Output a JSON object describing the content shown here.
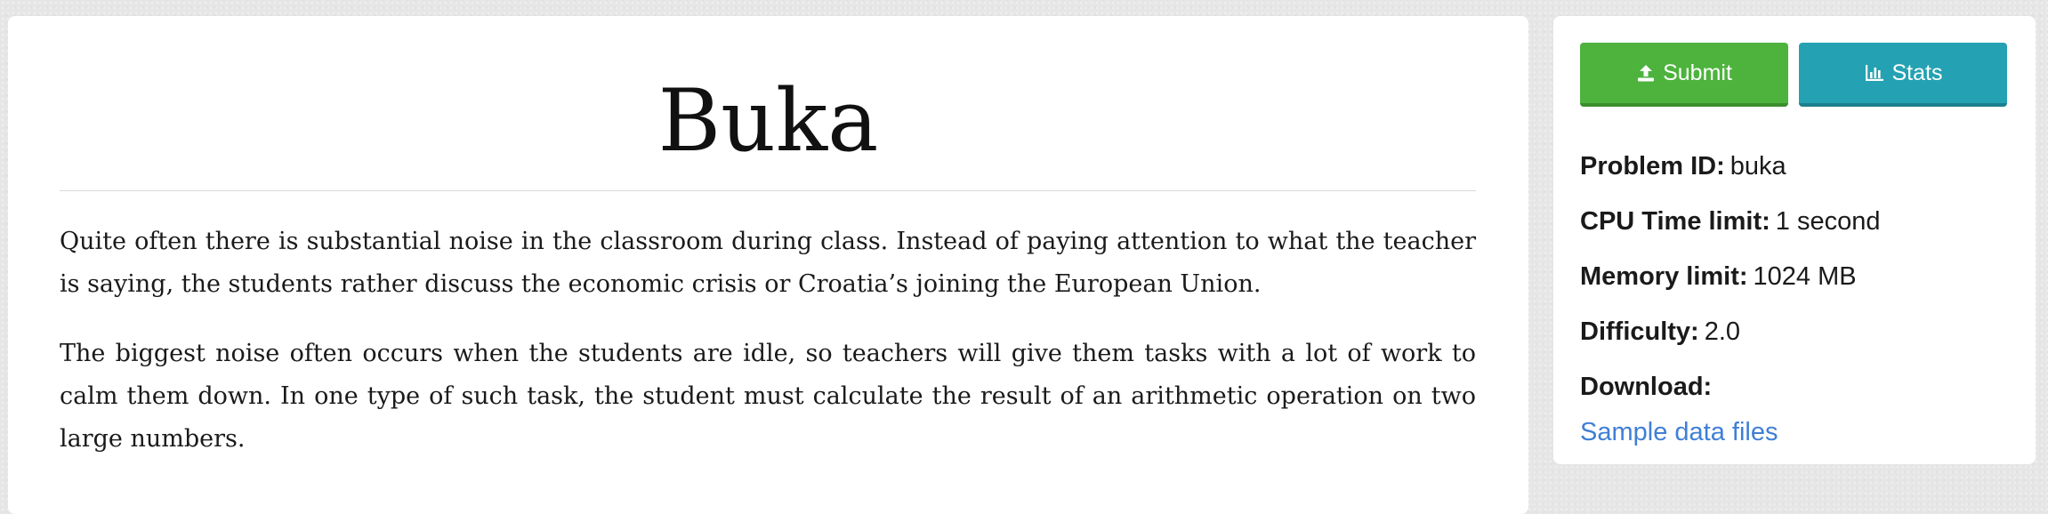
{
  "problem": {
    "title": "Buka",
    "paragraphs": [
      "Quite often there is substantial noise in the classroom during class. Instead of paying attention to what the teacher is saying, the students rather discuss the economic crisis or Croatia’s joining the European Union.",
      "The biggest noise often occurs when the students are idle, so teachers will give them tasks with a lot of work to calm them down. In one type of such task, the student must calculate the result of an arithmetic operation on two large numbers."
    ]
  },
  "sidebar": {
    "submit_label": "Submit",
    "stats_label": "Stats",
    "submit_icon": "upload-icon",
    "stats_icon": "bar-chart-icon",
    "problem_id_label": "Problem ID:",
    "problem_id_value": "buka",
    "cpu_label": "CPU Time limit:",
    "cpu_value": "1 second",
    "memory_label": "Memory limit:",
    "memory_value": "1024 MB",
    "difficulty_label": "Difficulty:",
    "difficulty_value": "2.0",
    "download_label": "Download:",
    "download_link": "Sample data files"
  },
  "colors": {
    "submit": "#4db33d",
    "stats": "#24a2b3",
    "link": "#3f7fd6"
  }
}
